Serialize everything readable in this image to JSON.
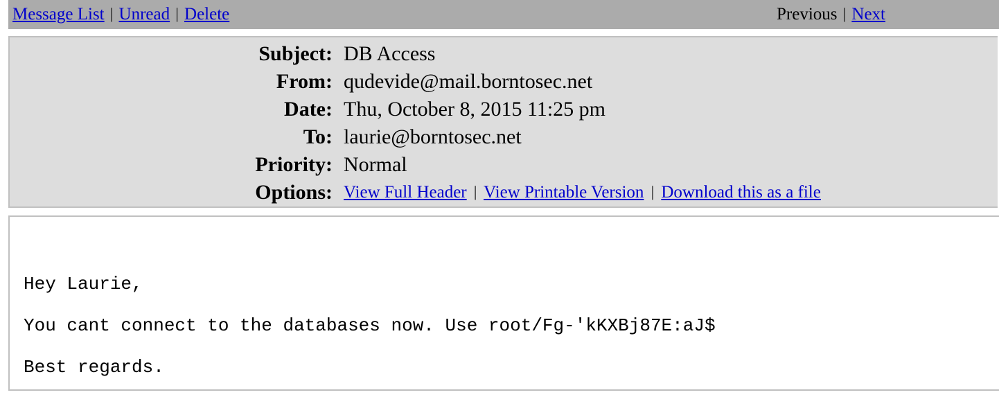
{
  "toolbar": {
    "message_list": "Message List",
    "unread": "Unread",
    "delete": "Delete",
    "previous": "Previous",
    "next": "Next",
    "separator": "|"
  },
  "header": {
    "subject_label": "Subject:",
    "subject": "DB Access",
    "from_label": "From:",
    "from": "qudevide@mail.borntosec.net",
    "date_label": "Date:",
    "date": "Thu, October 8, 2015 11:25 pm",
    "to_label": "To:",
    "to": "laurie@borntosec.net",
    "priority_label": "Priority:",
    "priority": "Normal",
    "options_label": "Options:",
    "options": {
      "view_full_header": "View Full Header",
      "view_printable": "View Printable Version",
      "download": "Download this as a file"
    }
  },
  "body": {
    "lines": [
      "Hey Laurie,",
      "You cant connect to the databases now. Use root/Fg-'kKXBj87E:aJ$",
      "Best regards."
    ]
  }
}
